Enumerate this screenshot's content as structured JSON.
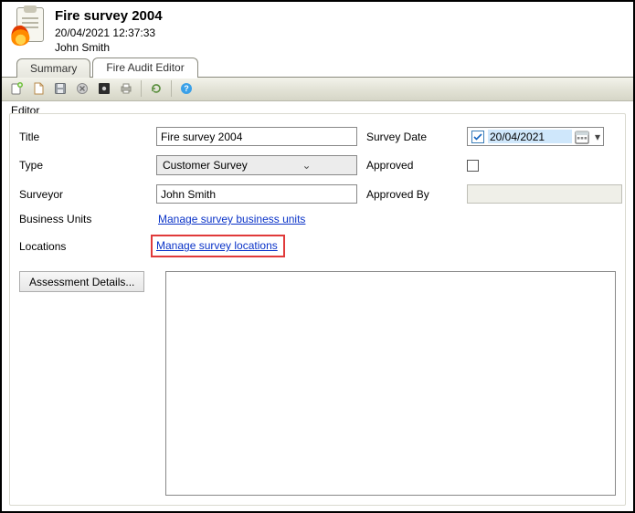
{
  "header": {
    "title": "Fire survey 2004",
    "timestamp": "20/04/2021 12:37:33",
    "user": "John Smith"
  },
  "tabs": {
    "summary": "Summary",
    "fireaudit": "Fire Audit Editor"
  },
  "group_label": "Editor",
  "labels": {
    "title": "Title",
    "type": "Type",
    "surveyor": "Surveyor",
    "business_units": "Business Units",
    "locations": "Locations",
    "survey_date": "Survey Date",
    "approved": "Approved",
    "approved_by": "Approved By"
  },
  "fields": {
    "title_value": "Fire survey 2004",
    "type_value": "Customer Survey",
    "surveyor_value": "John Smith",
    "survey_date_value": "20/04/2021",
    "approved_by_value": ""
  },
  "links": {
    "business_units": "Manage survey business units",
    "locations": "Manage survey locations"
  },
  "buttons": {
    "assessment": "Assessment Details..."
  },
  "toolbar_icons": {
    "new": "new-icon",
    "page": "page-icon",
    "save": "save-icon",
    "cancel": "cancel-icon",
    "stop": "stop-icon",
    "print": "print-icon",
    "refresh": "refresh-icon",
    "help": "help-icon"
  }
}
